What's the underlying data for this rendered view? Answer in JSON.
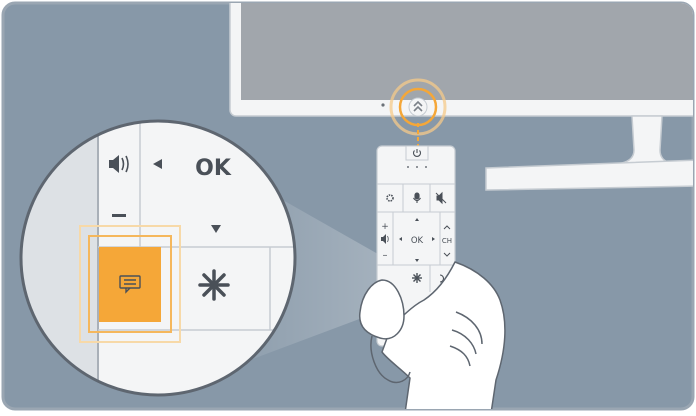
{
  "colors": {
    "background": "#8798a8",
    "frame": "#9aa6b2",
    "device_white": "#f4f5f6",
    "device_stroke": "#c6ccd2",
    "screen": "#a1a6ac",
    "highlight": "#f5a738",
    "icon_dark": "#4a5058"
  },
  "remote": {
    "ok_label": "OK",
    "ch_label": "CH",
    "icons": {
      "power": "power-icon",
      "settings": "gear-icon",
      "voice": "microphone-icon",
      "mute": "mute-icon",
      "volume": "volume-icon",
      "apps": "asterisk-icon",
      "return": "return-icon"
    }
  },
  "zoom": {
    "ok_label": "OK",
    "icons": {
      "volume": "volume-icon",
      "left_arrow": "triangle-left-icon",
      "down_arrow": "triangle-down-icon",
      "minus": "minus-icon",
      "highlighted": "menu-guide-icon",
      "apps": "asterisk-icon"
    }
  },
  "tv": {
    "icons": {
      "sensor": "double-chevron-up-icon"
    }
  }
}
